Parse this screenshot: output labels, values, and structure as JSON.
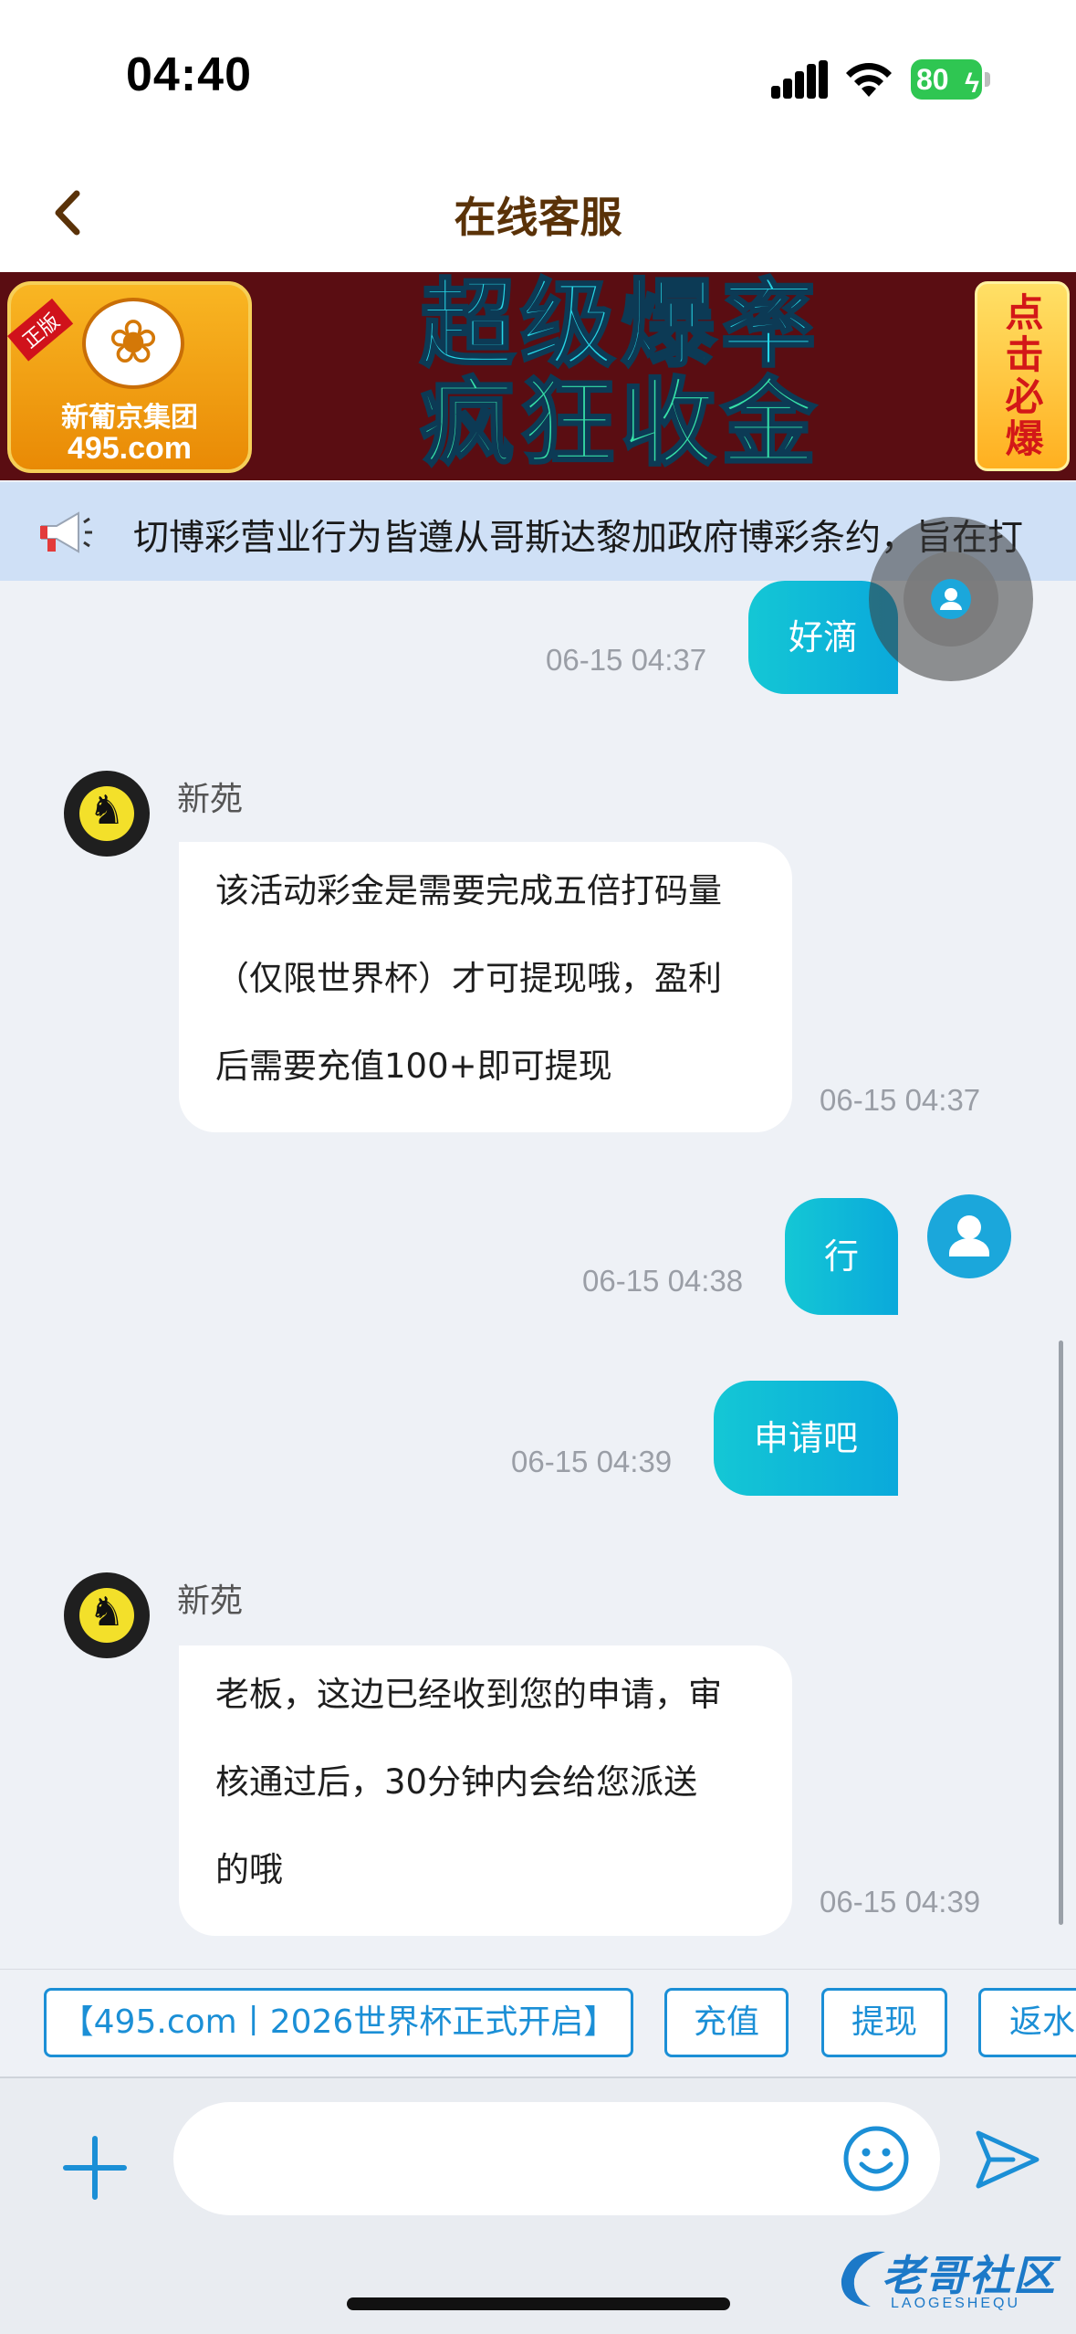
{
  "status_bar": {
    "time": "04:40",
    "battery": "80"
  },
  "nav": {
    "title": "在线客服"
  },
  "banner": {
    "ribbon": "正版",
    "logo_name": "新葡京集团",
    "logo_domain": "495.com",
    "headline_1": "超级爆率",
    "headline_2": "疯狂收金",
    "cta": "点击必爆"
  },
  "notice": {
    "text": "切博彩营业行为皆遵从哥斯达黎加政府博彩条约，旨在打"
  },
  "messages": [
    {
      "from": "user",
      "text": "好滴",
      "time": "06-15 04:37"
    },
    {
      "from": "agent",
      "name": "新苑",
      "lines": [
        "该活动彩金是需要完成五倍打码量",
        "（仅限世界杯）才可提现哦，盈利",
        "后需要充值100+即可提现"
      ],
      "time": "06-15 04:37"
    },
    {
      "from": "user",
      "text": "行",
      "time": "06-15 04:38"
    },
    {
      "from": "user",
      "text": "申请吧",
      "time": "06-15 04:39"
    },
    {
      "from": "agent",
      "name": "新苑",
      "lines": [
        "老板，这边已经收到您的申请，审",
        "核通过后，30分钟内会给您派送",
        "的哦"
      ],
      "time": "06-15 04:39"
    }
  ],
  "quick_replies": [
    "【495.com丨2026世界杯正式开启】",
    "充值",
    "提现",
    "返水"
  ],
  "input": {
    "placeholder": ""
  },
  "watermark": {
    "text": "老哥社区",
    "sub": "LAOGESHEQU"
  },
  "colors": {
    "accent": "#1b8fd6",
    "bubble_out": "#0fb8d8",
    "nav_title": "#5a3208"
  }
}
